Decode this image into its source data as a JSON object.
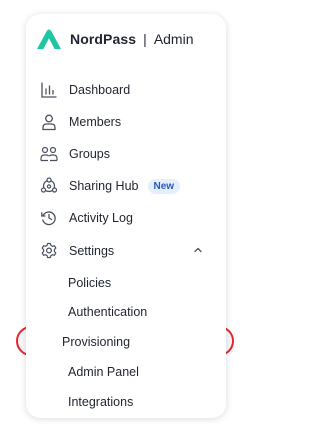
{
  "brand": {
    "name": "NordPass",
    "separator": "|",
    "section": "Admin",
    "logo_icon": "nordpass-mountain-logo",
    "logo_color": "#1ec6a4"
  },
  "nav": {
    "items": [
      {
        "label": "Dashboard",
        "icon": "bar-chart-icon"
      },
      {
        "label": "Members",
        "icon": "user-icon"
      },
      {
        "label": "Groups",
        "icon": "users-icon"
      },
      {
        "label": "Sharing Hub",
        "icon": "share-icon",
        "badge": "New"
      },
      {
        "label": "Activity Log",
        "icon": "history-icon"
      },
      {
        "label": "Settings",
        "icon": "gear-icon",
        "expanded": true
      }
    ],
    "settings_subitems": [
      {
        "label": "Policies"
      },
      {
        "label": "Authentication"
      },
      {
        "label": "Provisioning",
        "highlighted": true
      },
      {
        "label": "Admin Panel"
      },
      {
        "label": "Integrations"
      }
    ]
  },
  "colors": {
    "accent_teal": "#1ec6a4",
    "highlight_red": "#e8252f",
    "badge_bg": "#e4eefc",
    "badge_text": "#2a5ab8"
  }
}
